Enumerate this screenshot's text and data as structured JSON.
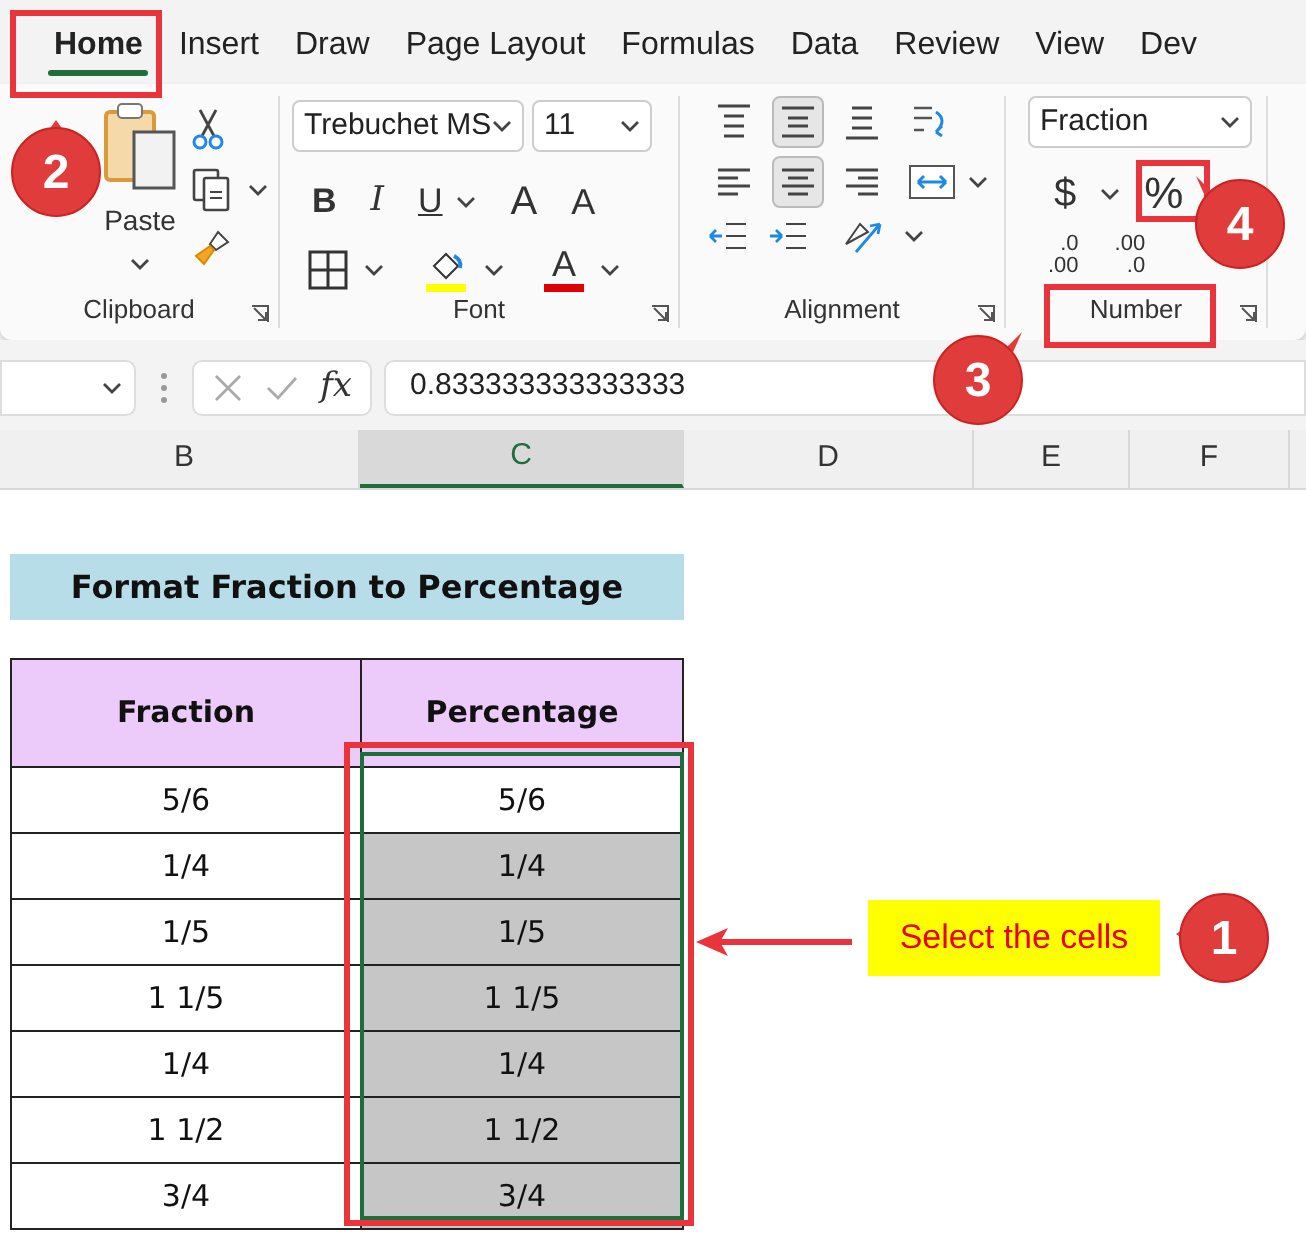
{
  "ribbon_tabs": [
    {
      "label": "Home",
      "selected": true
    },
    {
      "label": "Insert",
      "selected": false
    },
    {
      "label": "Draw",
      "selected": false
    },
    {
      "label": "Page Layout",
      "selected": false
    },
    {
      "label": "Formulas",
      "selected": false
    },
    {
      "label": "Data",
      "selected": false
    },
    {
      "label": "Review",
      "selected": false
    },
    {
      "label": "View",
      "selected": false
    },
    {
      "label": "Dev",
      "selected": false
    }
  ],
  "clipboard": {
    "paste_label": "Paste",
    "group_label": "Clipboard"
  },
  "font": {
    "name": "Trebuchet MS",
    "size": "11",
    "bold": "B",
    "italic": "I",
    "underline": "U",
    "grow": "A",
    "shrink": "A",
    "color_letter": "A",
    "group_label": "Font"
  },
  "alignment": {
    "group_label": "Alignment",
    "buttons": [
      {
        "kind": "top",
        "selected": false
      },
      {
        "kind": "middle",
        "selected": true
      },
      {
        "kind": "bottom",
        "selected": false
      },
      {
        "kind": "left",
        "selected": false
      },
      {
        "kind": "center",
        "selected": true
      },
      {
        "kind": "right",
        "selected": false
      }
    ]
  },
  "number": {
    "format": "Fraction",
    "currency": "$",
    "percent": "%",
    "decimals": [
      {
        "top": ".0",
        "bottom": ".00"
      },
      {
        "top": ".00",
        "bottom": ".0"
      }
    ],
    "group_label": "Number"
  },
  "formula_bar": {
    "fx": "fx",
    "value": "0.833333333333333"
  },
  "column_headers": [
    {
      "label": "B",
      "selected": false
    },
    {
      "label": "C",
      "selected": true
    },
    {
      "label": "D",
      "selected": false
    },
    {
      "label": "E",
      "selected": false
    },
    {
      "label": "F",
      "selected": false
    }
  ],
  "sheet": {
    "title": "Format Fraction to Percentage",
    "columns": [
      "Fraction",
      "Percentage"
    ],
    "rows": [
      {
        "fraction": "5/6",
        "percentage": "5/6",
        "selected": false
      },
      {
        "fraction": "1/4",
        "percentage": "1/4",
        "selected": true
      },
      {
        "fraction": "1/5",
        "percentage": "1/5",
        "selected": true
      },
      {
        "fraction": "1 1/5",
        "percentage": "1 1/5",
        "selected": true
      },
      {
        "fraction": "1/4",
        "percentage": "1/4",
        "selected": true
      },
      {
        "fraction": "1 1/2",
        "percentage": "1 1/2",
        "selected": true
      },
      {
        "fraction": "3/4",
        "percentage": "3/4",
        "selected": true
      }
    ]
  },
  "annotations": {
    "callout": "Select the cells",
    "steps": [
      "1",
      "2",
      "3",
      "4"
    ]
  }
}
